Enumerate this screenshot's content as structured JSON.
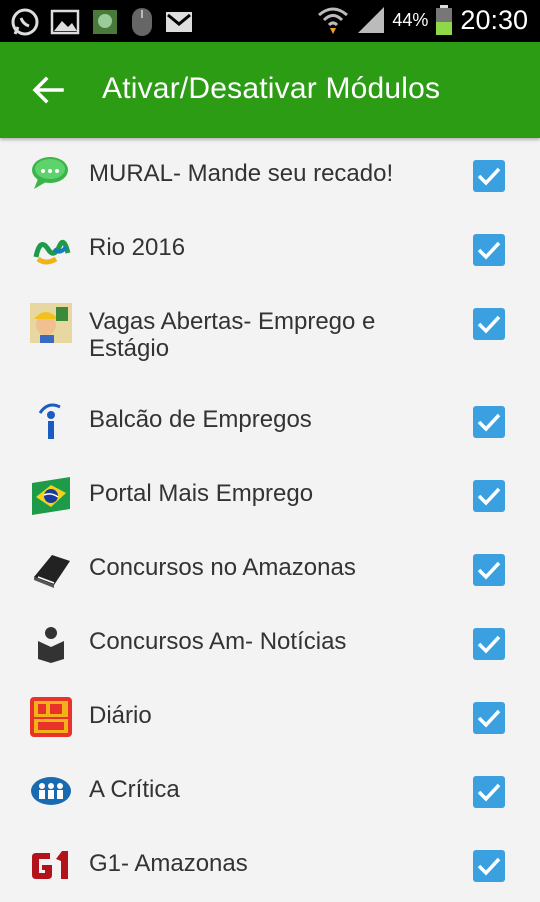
{
  "status_bar": {
    "battery_percent": "44%",
    "time": "20:30",
    "icons": [
      "whatsapp-icon",
      "gallery-icon",
      "app-icon",
      "mouse-icon",
      "gmail-icon",
      "wifi-icon",
      "signal-icon",
      "battery-icon"
    ]
  },
  "app_bar": {
    "back_icon": "arrow-left-icon",
    "title": "Ativar/Desativar Módulos",
    "color": "#2b9c14"
  },
  "modules": [
    {
      "label": "MURAL- Mande seu recado!",
      "icon": "chat-bubble-icon",
      "checked": true
    },
    {
      "label": "Rio 2016",
      "icon": "rio2016-logo-icon",
      "checked": true
    },
    {
      "label": "Vagas Abertas- Emprego e Estágio",
      "icon": "worker-icon",
      "checked": true
    },
    {
      "label": "Balcão de Empregos",
      "icon": "info-icon",
      "checked": true
    },
    {
      "label": "Portal Mais Emprego",
      "icon": "brazil-flag-icon",
      "checked": true
    },
    {
      "label": "Concursos no Amazonas",
      "icon": "book-icon",
      "checked": true
    },
    {
      "label": "Concursos Am- Notícias",
      "icon": "reader-icon",
      "checked": true
    },
    {
      "label": "Diário",
      "icon": "d24am-logo-icon",
      "checked": true
    },
    {
      "label": "A Crítica",
      "icon": "people-circle-icon",
      "checked": true
    },
    {
      "label": "G1- Amazonas",
      "icon": "g1-logo-icon",
      "checked": true
    }
  ],
  "checkbox_color": "#3aa0e0"
}
